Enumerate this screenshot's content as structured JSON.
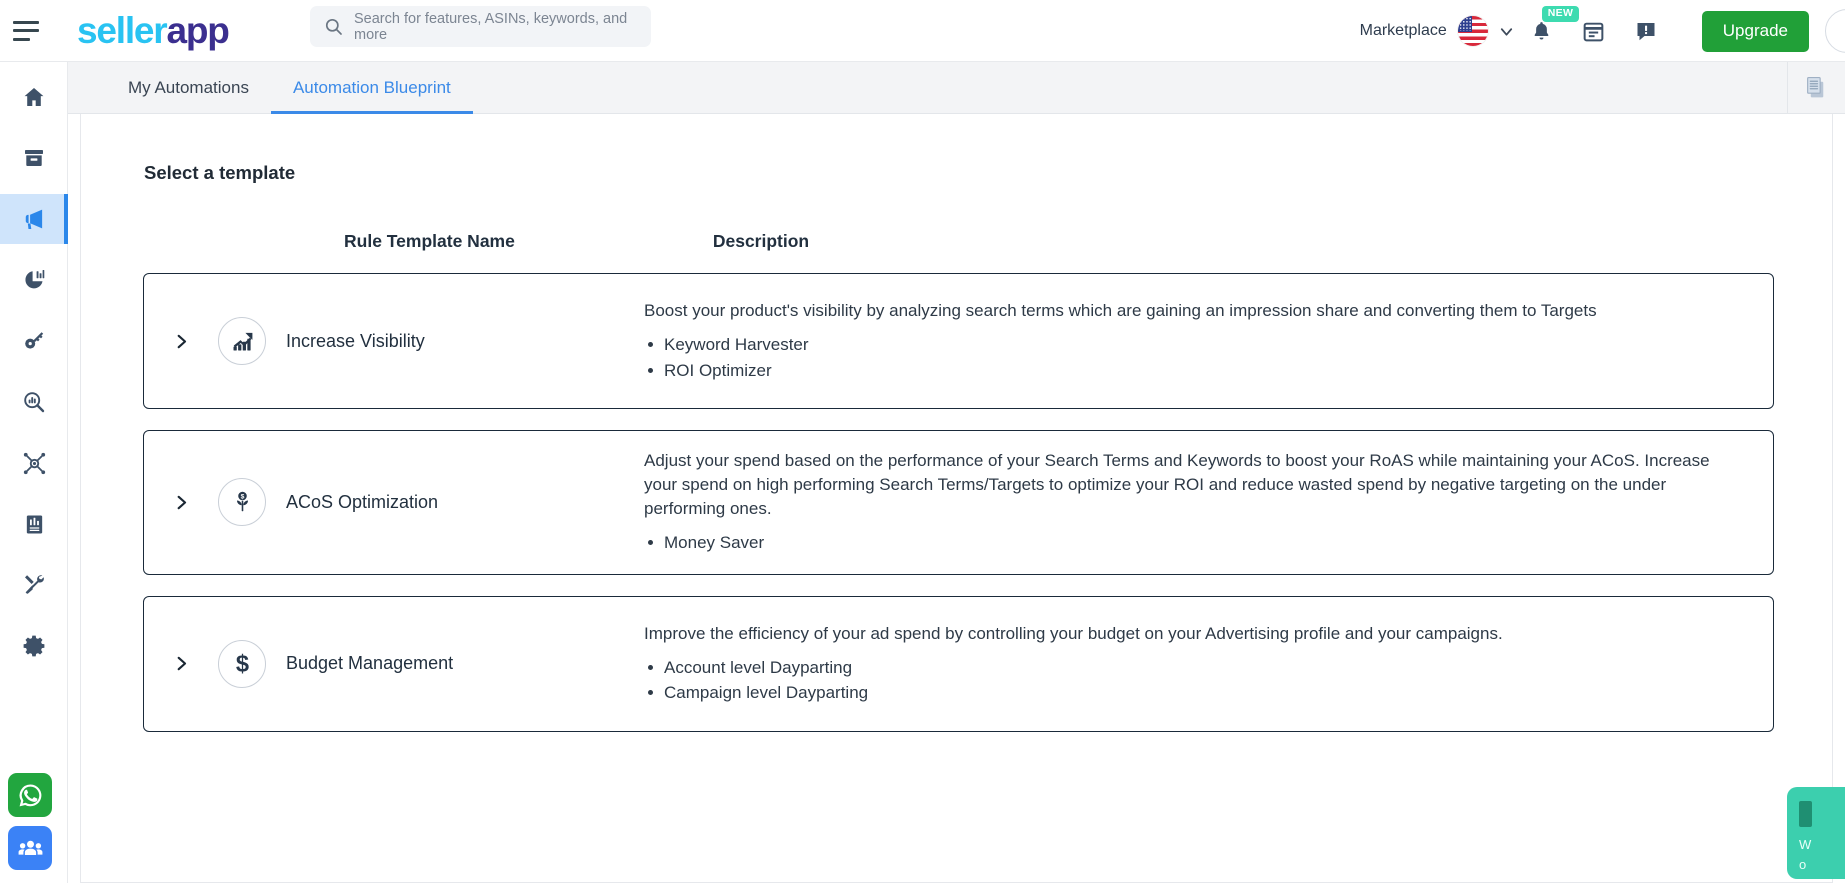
{
  "brand": {
    "logo_part1": "seller",
    "logo_part2": "app",
    "accent_blue": "#29c3f2",
    "accent_purple": "#3b2f8f"
  },
  "topbar": {
    "menu_icon": "hamburger-menu-icon",
    "search": {
      "icon": "search-icon",
      "placeholder": "Search for features, ASINs, keywords, and more",
      "value": ""
    },
    "marketplace_label": "Marketplace",
    "marketplace_flag": "us-flag-icon",
    "marketplace_chevron": "chevron-down-icon",
    "notifications": {
      "icon": "bell-icon",
      "badge": "NEW"
    },
    "calendar_icon": "calendar-icon",
    "feedback_icon": "feedback-alert-icon",
    "upgrade_label": "Upgrade",
    "upgrade_color": "#21a038",
    "avatar": "user-avatar"
  },
  "sidebar": {
    "items": [
      {
        "name": "home",
        "icon": "home-icon",
        "active": false
      },
      {
        "name": "products",
        "icon": "archive-box-icon",
        "active": false
      },
      {
        "name": "advertising",
        "icon": "megaphone-icon",
        "active": true
      },
      {
        "name": "analytics",
        "icon": "pie-chart-icon",
        "active": false
      },
      {
        "name": "keywords",
        "icon": "key-icon",
        "active": false
      },
      {
        "name": "research",
        "icon": "search-chart-icon",
        "active": false
      },
      {
        "name": "network",
        "icon": "hub-network-icon",
        "active": false
      },
      {
        "name": "reports",
        "icon": "report-book-icon",
        "active": false
      },
      {
        "name": "tools",
        "icon": "tools-hammer-wrench-icon",
        "active": false
      },
      {
        "name": "settings",
        "icon": "gear-icon",
        "active": false
      }
    ],
    "floating": [
      {
        "name": "whatsapp",
        "icon": "whatsapp-icon",
        "color": "#22a63f"
      },
      {
        "name": "community",
        "icon": "people-group-icon",
        "color": "#3b82f6"
      }
    ]
  },
  "tabs": {
    "items": [
      {
        "label": "My Automations",
        "active": false
      },
      {
        "label": "Automation Blueprint",
        "active": true
      }
    ],
    "active_color": "#3b8ae8",
    "right_action_icon": "documents-copy-icon"
  },
  "main": {
    "panel_title": "Select a template",
    "columns": {
      "name": "Rule Template Name",
      "description": "Description"
    },
    "templates": [
      {
        "expand_icon": "chevron-right-icon",
        "icon": "trending-up-chart-icon",
        "name": "Increase Visibility",
        "description": "Boost your product's visibility by analyzing search terms which are gaining an impression share and converting them to Targets",
        "rules": [
          "Keyword Harvester",
          "ROI Optimizer"
        ]
      },
      {
        "expand_icon": "chevron-right-icon",
        "icon": "money-plant-icon",
        "name": "ACoS Optimization",
        "description": "Adjust your spend based on the performance of your Search Terms and Keywords to boost your RoAS while maintaining your ACoS. Increase your spend on high performing Search Terms/Targets to optimize your ROI and reduce wasted spend by negative targeting on the under performing ones.",
        "rules": [
          "Money Saver"
        ]
      },
      {
        "expand_icon": "chevron-right-icon",
        "icon": "dollar-sign-icon",
        "name": "Budget Management",
        "description": "Improve the efficiency of your ad spend by controlling your budget on your Advertising profile and your campaigns.",
        "rules": [
          "Account level Dayparting",
          "Campaign level Dayparting"
        ]
      }
    ]
  },
  "chat_widget": {
    "line1": "W",
    "line2": "o",
    "color": "#3ccfae"
  }
}
